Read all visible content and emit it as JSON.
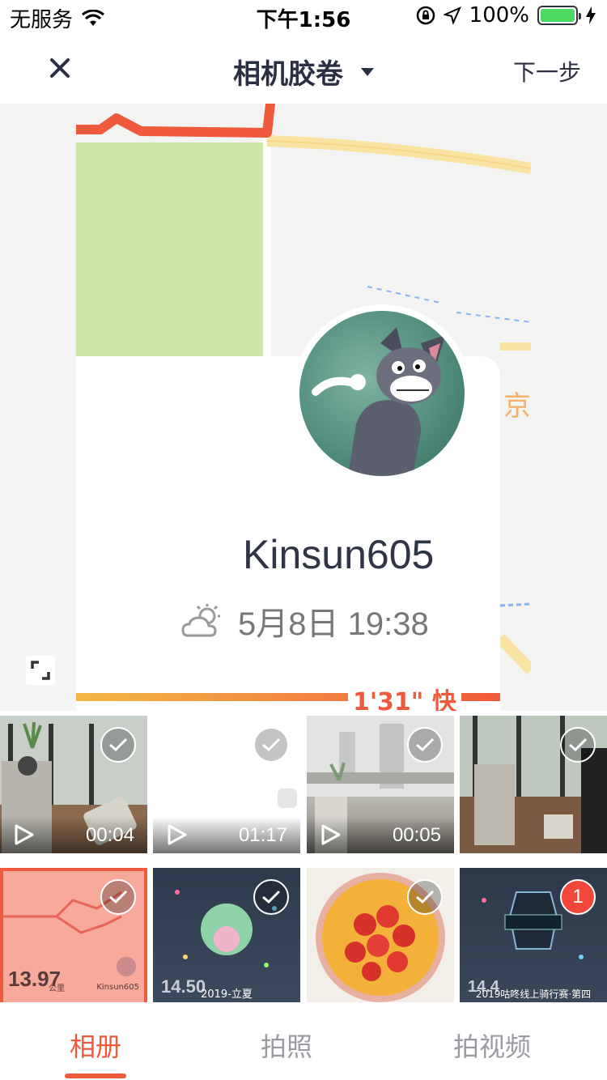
{
  "status_bar": {
    "carrier": "无服务",
    "time": "下午1:56",
    "battery": "100%",
    "battery_level": 1.0
  },
  "nav": {
    "title": "相机胶卷",
    "next": "下一步"
  },
  "preview": {
    "username": "Kinsun605",
    "date_time": "5月8日 19:38",
    "pace": "1'31\" 快",
    "map_label": "京",
    "weather_icon": "partly-cloudy-icon",
    "colors": {
      "route": "#f05a3c",
      "accent": "#f05a3c",
      "park": "#cde8a6",
      "road": "#f9e3a3"
    }
  },
  "grid": {
    "items": [
      {
        "type": "video",
        "duration": "00:04"
      },
      {
        "type": "video",
        "duration": "01:17"
      },
      {
        "type": "video",
        "duration": "00:05"
      },
      {
        "type": "photo"
      },
      {
        "type": "photo",
        "stat_value": "13.97",
        "stat_unit": "公里",
        "stat_label": "Kinsun605"
      },
      {
        "type": "photo",
        "stat_value": "14.50",
        "caption": "2019-立夏"
      },
      {
        "type": "photo"
      },
      {
        "type": "photo",
        "stat_value": "14.4",
        "caption": "2019咕咚线上骑行赛·第四",
        "selected_index": "1"
      }
    ]
  },
  "tabs": [
    {
      "label": "相册",
      "active": true
    },
    {
      "label": "拍照",
      "active": false
    },
    {
      "label": "拍视频",
      "active": false
    }
  ]
}
